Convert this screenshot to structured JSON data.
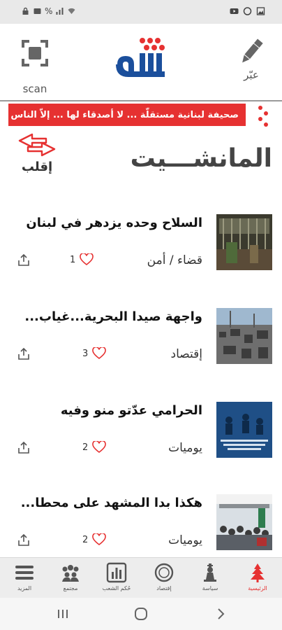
{
  "status_bar": {
    "battery": "%",
    "left_icons": [
      "lock-icon",
      "battery-icon",
      "signal-icon",
      "wifi-icon"
    ],
    "right_icons": [
      "youtube-icon",
      "whatsapp-icon",
      "image-icon"
    ]
  },
  "header": {
    "scan_label": "scan",
    "write_label": "عبّر",
    "logo_alt": "ناس"
  },
  "banner": {
    "text": "صحيفة لبنانية مستقلّة ... لا أصدقاء لها ... إلاّ الناس"
  },
  "section": {
    "title": "المانشـــيت",
    "flip_label": "إقلب"
  },
  "articles": [
    {
      "title": "السلاح وحده يزدهر في لبنان",
      "category": "قضاء / أمن",
      "likes": "1"
    },
    {
      "title": "واجهة صيدا البحرية...غياب...",
      "category": "إقتصاد",
      "likes": "3"
    },
    {
      "title": "الحرامي عدّتو منو وفيه",
      "category": "يوميات",
      "likes": "2"
    },
    {
      "title": "هكذا بدا المشهد على محطا...",
      "category": "يوميات",
      "likes": "2"
    }
  ],
  "bottom_nav": [
    {
      "label": "المزيد"
    },
    {
      "label": "مجتمع"
    },
    {
      "label": "حُكم الشعب"
    },
    {
      "label": "إقتصاد"
    },
    {
      "label": "سياسة"
    },
    {
      "label": "الرئيسية"
    }
  ],
  "colors": {
    "accent": "#e63131",
    "logo_blue": "#1b4f9c",
    "heart": "#e63131"
  }
}
